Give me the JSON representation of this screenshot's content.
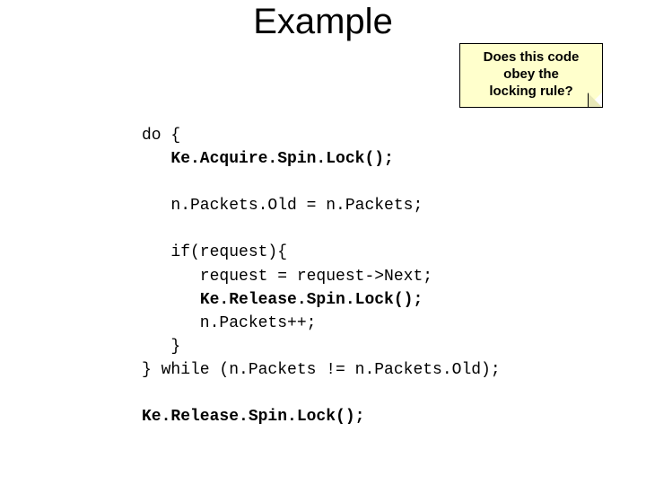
{
  "title": "Example",
  "callout": {
    "line1": "Does this code",
    "line2": "obey the",
    "line3": "locking rule?"
  },
  "code": {
    "l1": "do {",
    "l2": "Ke.Acquire.Spin.Lock();",
    "l3": "",
    "l4": "   n.Packets.Old = n.Packets;",
    "l5": "",
    "l6": "   if(request){",
    "l7": "      request = request->Next;",
    "l8": "Ke.Release.Spin.Lock();",
    "l9": "      n.Packets++;",
    "l10": "   }",
    "l11": "} while (n.Packets != n.Packets.Old);",
    "l12": "",
    "l13": "Ke.Release.Spin.Lock();"
  }
}
